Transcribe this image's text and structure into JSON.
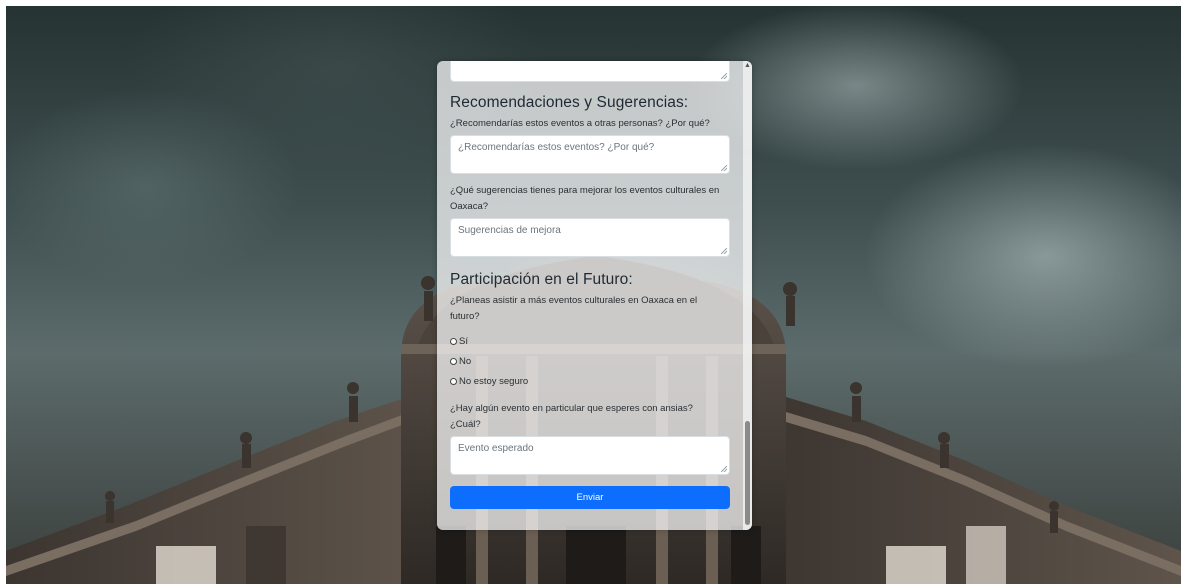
{
  "form": {
    "section_recommendations": {
      "title": "Recomendaciones y Sugerencias:",
      "q1_label": "¿Recomendarías estos eventos a otras personas? ¿Por qué?",
      "q1_placeholder": "¿Recomendarías estos eventos? ¿Por qué?",
      "q2_label": "¿Qué sugerencias tienes para mejorar los eventos culturales en Oaxaca?",
      "q2_placeholder": "Sugerencias de mejora"
    },
    "section_future": {
      "title": "Participación en el Futuro:",
      "q1_label": "¿Planeas asistir a más eventos culturales en Oaxaca en el futuro?",
      "options": [
        "Sí",
        "No",
        "No estoy seguro"
      ],
      "q2_label": "¿Hay algún evento en particular que esperes con ansias? ¿Cuál?",
      "q2_placeholder": "Evento esperado"
    },
    "submit_label": "Enviar"
  },
  "colors": {
    "primary_button": "#0d6efd",
    "card_background": "rgba(255,255,255,0.72)"
  }
}
